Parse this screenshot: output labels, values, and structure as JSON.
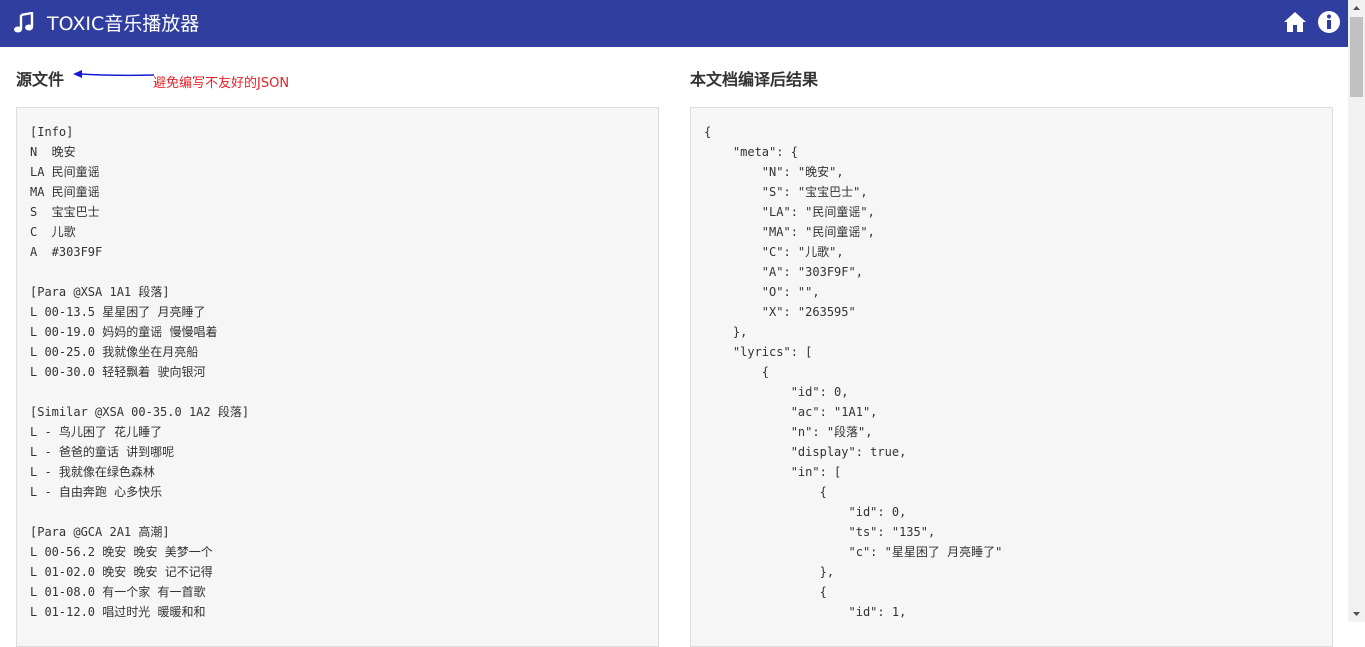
{
  "app": {
    "title": "TOXIC音乐播放器",
    "logo_icon": "music-note-icon",
    "brand_color": "#303F9F",
    "home_icon": "home-icon",
    "info_icon": "info-icon"
  },
  "source_panel": {
    "heading": "源文件",
    "annotation": "避免编写不友好的JSON",
    "annotation_color": "#e8202a",
    "arrow_color": "#1a1ad6",
    "code": "[Info]\nN  晚安\nLA 民间童谣\nMA 民间童谣\nS  宝宝巴士\nC  儿歌\nA  #303F9F\n\n[Para @XSA 1A1 段落]\nL 00-13.5 星星困了 月亮睡了\nL 00-19.0 妈妈的童谣 慢慢唱着\nL 00-25.0 我就像坐在月亮船\nL 00-30.0 轻轻飘着 驶向银河\n\n[Similar @XSA 00-35.0 1A2 段落]\nL - 鸟儿困了 花儿睡了\nL - 爸爸的童话 讲到哪呢\nL - 我就像在绿色森林\nL - 自由奔跑 心多快乐\n\n[Para @GCA 2A1 高潮]\nL 00-56.2 晚安 晚安 美梦一个\nL 01-02.0 晚安 晚安 记不记得\nL 01-08.0 有一个家 有一首歌\nL 01-12.0 唱过时光 暖暖和和"
  },
  "result_panel": {
    "heading": "本文档编译后结果",
    "code": "{\n    \"meta\": {\n        \"N\": \"晚安\",\n        \"S\": \"宝宝巴士\",\n        \"LA\": \"民间童谣\",\n        \"MA\": \"民间童谣\",\n        \"C\": \"儿歌\",\n        \"A\": \"303F9F\",\n        \"O\": \"\",\n        \"X\": \"263595\"\n    },\n    \"lyrics\": [\n        {\n            \"id\": 0,\n            \"ac\": \"1A1\",\n            \"n\": \"段落\",\n            \"display\": true,\n            \"in\": [\n                {\n                    \"id\": 0,\n                    \"ts\": \"135\",\n                    \"c\": \"星星困了 月亮睡了\"\n                },\n                {\n                    \"id\": 1,"
  }
}
